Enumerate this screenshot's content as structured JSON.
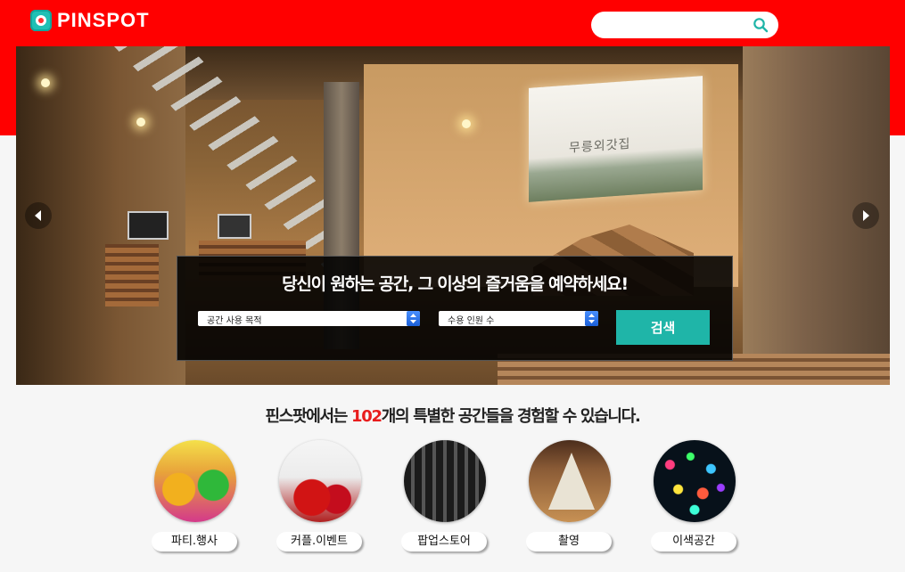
{
  "header": {
    "logo_text": "PINSPOT",
    "search": {
      "placeholder": ""
    },
    "colors": {
      "brand_red": "#ff0000",
      "accent_teal": "#1fb5a8"
    }
  },
  "hero": {
    "screen_text": "무릉외갓집",
    "panel": {
      "title": "당신이 원하는 공간, 그 이상의 즐거움을 예약하세요!",
      "purpose_select": {
        "selected": "공간 사용 목적"
      },
      "capacity_select": {
        "selected": "수용 인원 수"
      },
      "search_button": "검색"
    },
    "prev_icon": "chevron-left-icon",
    "next_icon": "chevron-right-icon"
  },
  "headline": {
    "prefix": "핀스팟에서는 ",
    "count": "102",
    "suffix": "개의 특별한 공간들을 경험할 수 있습니다."
  },
  "categories": [
    {
      "label": "파티.행사"
    },
    {
      "label": "커플.이벤트"
    },
    {
      "label": "팝업스토어"
    },
    {
      "label": "촬영"
    },
    {
      "label": "이색공간"
    }
  ]
}
